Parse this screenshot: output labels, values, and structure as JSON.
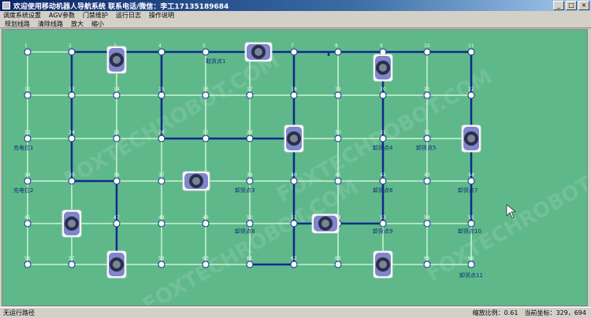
{
  "window": {
    "title": "欢迎使用移动机器人导航系统  联系电话/微信：李工17135189684",
    "min_icon": "minimize-icon",
    "max_icon": "maximize-icon",
    "close_icon": "close-icon"
  },
  "menu": [
    "调度系统设置",
    "AGV参数",
    "门禁维护",
    "运行日志",
    "操作说明"
  ],
  "toolbar": [
    "规划线路",
    "清除线路",
    "放大",
    "缩小"
  ],
  "status": {
    "left": "无运行路径",
    "scale_label": "缩放比例：0.61",
    "coords_label": "当前坐标：329，694"
  },
  "watermark": "FOXTECHROBOT.COM",
  "colors": {
    "background": "#5fb88a",
    "grid_line": "#c8f5d8",
    "path_line": "#0d2a8c",
    "node_fill": "#ffffff",
    "agv_body": "#7f86c9"
  },
  "node_labels": [
    "1",
    "2",
    "3",
    "4",
    "5",
    "6",
    "7",
    "8",
    "9",
    "10",
    "11",
    "12",
    "13",
    "14",
    "15",
    "16",
    "17",
    "18",
    "19",
    "20",
    "21",
    "22",
    "23",
    "24",
    "25",
    "26",
    "27",
    "28",
    "29",
    "30",
    "31",
    "32",
    "33",
    "34",
    "35",
    "36",
    "37",
    "38",
    "39",
    "40",
    "41",
    "42",
    "43",
    "44",
    "45",
    "46",
    "47",
    "48",
    "49",
    "50",
    "51",
    "52",
    "53",
    "54",
    "55",
    "56",
    "57",
    "58",
    "59",
    "60",
    "61",
    "62",
    "63",
    "64",
    "65",
    "66"
  ],
  "stations": [
    {
      "label": "取货点1"
    },
    {
      "label": "充电位1"
    },
    {
      "label": "充电位2"
    },
    {
      "label": "卸货点3"
    },
    {
      "label": "卸货点4"
    },
    {
      "label": "卸货点5"
    },
    {
      "label": "卸货点6"
    },
    {
      "label": "卸货点7"
    },
    {
      "label": "卸货点8"
    },
    {
      "label": "卸货点9"
    },
    {
      "label": "卸货点10"
    },
    {
      "label": "卸货点11"
    }
  ]
}
